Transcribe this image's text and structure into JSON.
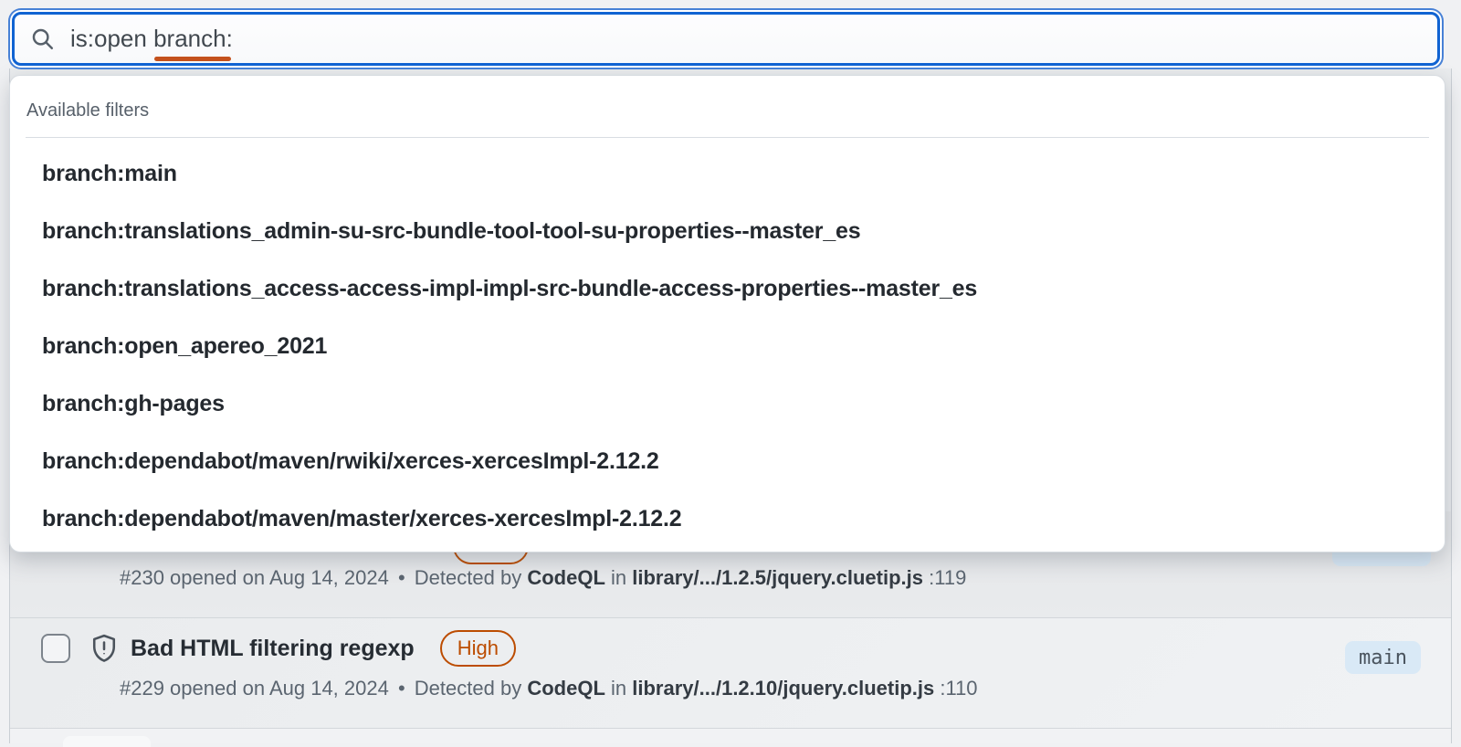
{
  "search": {
    "value_before": "is:open ",
    "active_token": "branch:"
  },
  "dropdown": {
    "header": "Available filters",
    "items": [
      "branch:main",
      "branch:translations_admin-su-src-bundle-tool-tool-su-properties--master_es",
      "branch:translations_access-access-impl-impl-src-bundle-access-properties--master_es",
      "branch:open_apereo_2021",
      "branch:gh-pages",
      "branch:dependabot/maven/rwiki/xerces-xercesImpl-2.12.2",
      "branch:dependabot/maven/master/xerces-xercesImpl-2.12.2"
    ]
  },
  "alerts": {
    "alert_230": {
      "id_text": "#230 opened on Aug 14, 2024",
      "dot": "•",
      "detected_by": "Detected by",
      "tool": "CodeQL",
      "in_word": "in",
      "path": "library/.../1.2.5/jquery.cluetip.js",
      "line_ref": ":119"
    },
    "alert_229": {
      "title": "Bad HTML filtering regexp",
      "severity": "High",
      "branch_label": "main",
      "id_text": "#229 opened on Aug 14, 2024",
      "dot": "•",
      "detected_by": "Detected by",
      "tool": "CodeQL",
      "in_word": "in",
      "path": "library/.../1.2.10/jquery.cluetip.js",
      "line_ref": ":110"
    }
  },
  "colors": {
    "focus_blue": "#1063d2",
    "token_underline": "#c4511d",
    "severity_high": "#bc4c00",
    "branch_badge_bg": "#d9e9f6",
    "panel_bg": "#ffffff",
    "muted_text": "#57606a"
  }
}
